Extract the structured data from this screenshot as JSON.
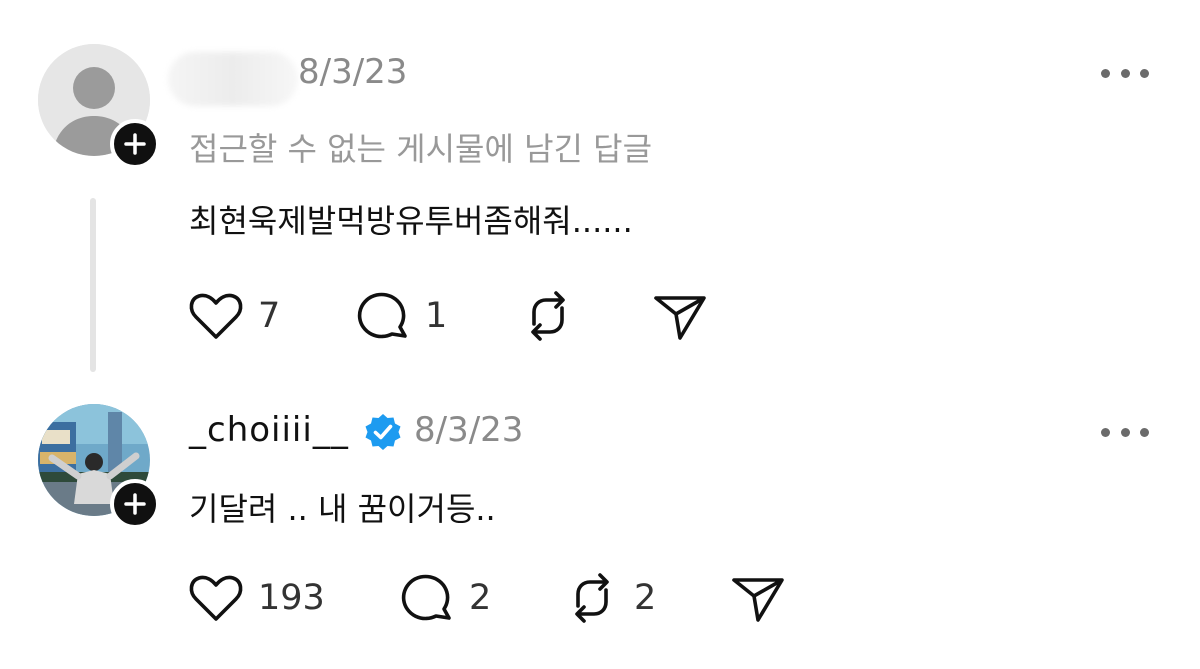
{
  "posts": [
    {
      "username": "",
      "timestamp": "8/3/23",
      "notice": "접근할 수 없는 게시물에 남긴 답글",
      "body": "최현욱제발먹방유투버좀해줘......",
      "likes": "7",
      "replies": "1",
      "reposts": "",
      "icons": [
        "heart-icon",
        "comment-icon",
        "repost-icon",
        "send-icon"
      ]
    },
    {
      "username": "_choiiii__",
      "verified": true,
      "timestamp": "8/3/23",
      "body": "기달려 .. 내 꿈이거등..",
      "likes": "193",
      "replies": "2",
      "reposts": "2",
      "icons": [
        "heart-icon",
        "comment-icon",
        "repost-icon",
        "send-icon"
      ]
    }
  ],
  "colors": {
    "verified": "#1d9bf0",
    "muted": "#999999",
    "text": "#111111"
  }
}
